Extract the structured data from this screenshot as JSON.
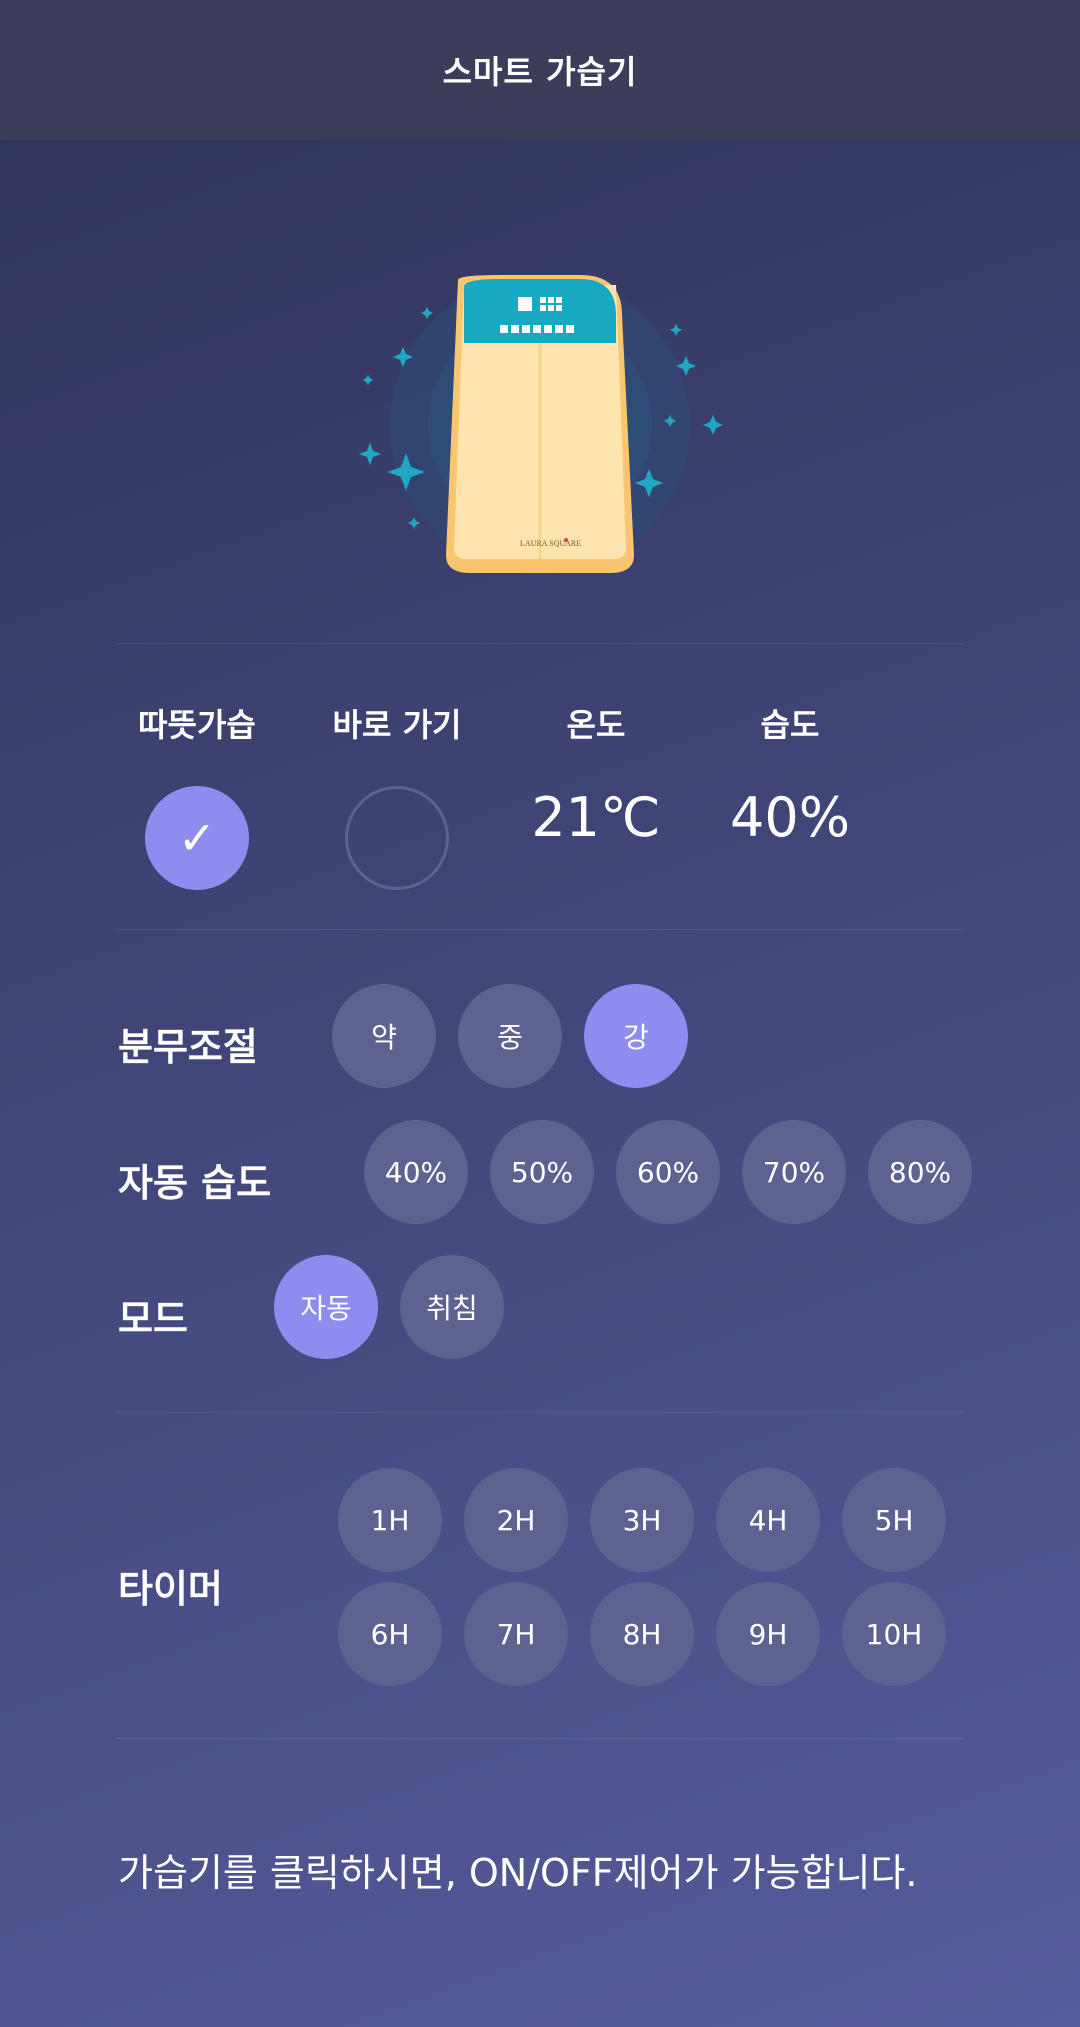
{
  "header": {
    "title": "스마트 가습기"
  },
  "device": {
    "brand_text": "LAURA SQUARE"
  },
  "status": {
    "warm_label": "따뜻가습",
    "shortcut_label": "바로 가기",
    "temperature_label": "온도",
    "temperature_value": "21℃",
    "humidity_label": "습도",
    "humidity_value": "40%",
    "check_icon": "✓"
  },
  "controls": {
    "mist": {
      "label": "분무조절",
      "options": [
        "약",
        "중",
        "강"
      ],
      "selected": "강"
    },
    "auto_humidity": {
      "label": "자동 습도",
      "options": [
        "40%",
        "50%",
        "60%",
        "70%",
        "80%"
      ]
    },
    "mode": {
      "label": "모드",
      "options": [
        "자동",
        "취침"
      ],
      "selected": "자동"
    },
    "timer": {
      "label": "타이머",
      "options": [
        "1H",
        "2H",
        "3H",
        "4H",
        "5H",
        "6H",
        "7H",
        "8H",
        "9H",
        "10H"
      ]
    }
  },
  "footer": {
    "note": "가습기를 클릭하시면, ON/OFF제어가 가능합니다."
  },
  "colors": {
    "accent": "#8f8cf0",
    "button": "#5e6290",
    "header": "#3b3d5a",
    "device_top": "#17a9c1",
    "device_body": "#fde4ae"
  }
}
